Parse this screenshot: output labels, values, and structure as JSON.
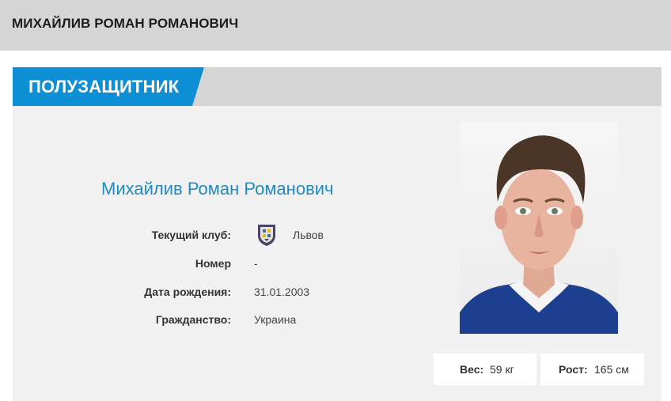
{
  "page": {
    "title": "МИХАЙЛИВ РОМАН РОМАНОВИЧ"
  },
  "section": {
    "position": "ПОЛУЗАЩИТНИК"
  },
  "player": {
    "full_name": "Михайлив Роман Романович",
    "club_label": "Текущий клуб:",
    "club_name": "Львов",
    "club_logo_icon": "club-crest-icon",
    "number_label": "Номер",
    "number_value": "-",
    "birth_label": "Дата рождения:",
    "birth_value": "31.01.2003",
    "citizenship_label": "Гражданство:",
    "citizenship_value": "Украина",
    "weight_label": "Вес:",
    "weight_value": "59 кг",
    "height_label": "Рост:",
    "height_value": "165 см"
  },
  "colors": {
    "accent": "#0d8fd6",
    "name_blue": "#1e8bc3",
    "header_gray": "#d5d5d5",
    "panel_bg": "#f2f1f2"
  }
}
